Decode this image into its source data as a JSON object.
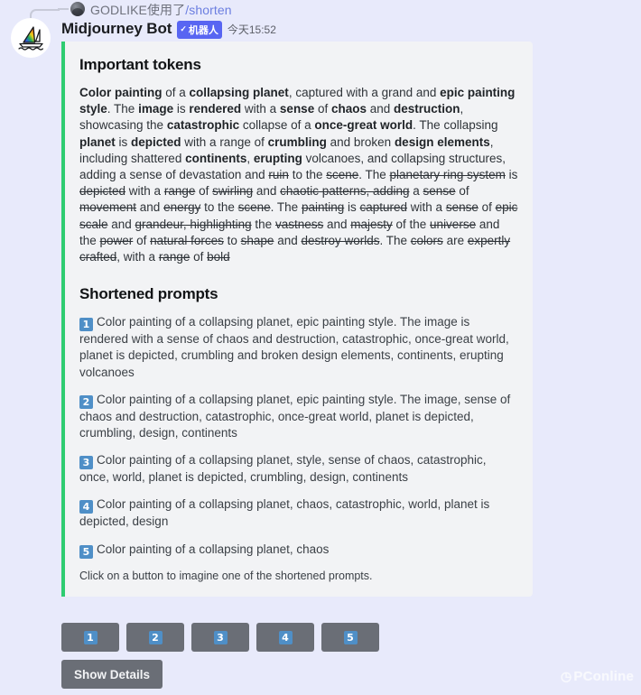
{
  "reply": {
    "username": "GODLIKE",
    "action": "使用了",
    "command": "/shorten",
    "avatar_icon": "user-avatar-icon"
  },
  "message": {
    "author": "Midjourney Bot",
    "bot_badge_check": "✓",
    "bot_badge_label": "机器人",
    "timestamp": "今天15:52",
    "avatar_icon": "midjourney-sailboat-icon"
  },
  "embed": {
    "accent_color": "#2ecc71",
    "background_color": "#f2f3f5",
    "tokens_title": "Important tokens",
    "prompts_title": "Shortened prompts",
    "footnote": "Click on a button to imagine one of the shortened prompts.",
    "tokens_segments": [
      {
        "text": "Color painting",
        "style": "bold"
      },
      {
        "text": " of a ",
        "style": "normal"
      },
      {
        "text": "collapsing planet",
        "style": "bold"
      },
      {
        "text": ", captured with a grand and ",
        "style": "normal"
      },
      {
        "text": "epic painting style",
        "style": "bold"
      },
      {
        "text": ". The ",
        "style": "normal"
      },
      {
        "text": "image",
        "style": "bold"
      },
      {
        "text": " is ",
        "style": "normal"
      },
      {
        "text": "rendered",
        "style": "bold"
      },
      {
        "text": " with a ",
        "style": "normal"
      },
      {
        "text": "sense",
        "style": "bold"
      },
      {
        "text": " of ",
        "style": "normal"
      },
      {
        "text": "chaos",
        "style": "bold"
      },
      {
        "text": " and ",
        "style": "normal"
      },
      {
        "text": "destruction",
        "style": "bold"
      },
      {
        "text": ", showcasing the ",
        "style": "normal"
      },
      {
        "text": "catastrophic",
        "style": "bold"
      },
      {
        "text": " collapse of a ",
        "style": "normal"
      },
      {
        "text": "once-great world",
        "style": "bold"
      },
      {
        "text": ". The collapsing ",
        "style": "normal"
      },
      {
        "text": "planet",
        "style": "bold"
      },
      {
        "text": " is ",
        "style": "normal"
      },
      {
        "text": "depicted",
        "style": "bold"
      },
      {
        "text": " with a range of ",
        "style": "normal"
      },
      {
        "text": "crumbling",
        "style": "bold"
      },
      {
        "text": " and broken ",
        "style": "normal"
      },
      {
        "text": "design elements",
        "style": "bold"
      },
      {
        "text": ", including shattered ",
        "style": "normal"
      },
      {
        "text": "continents",
        "style": "bold"
      },
      {
        "text": ", ",
        "style": "normal"
      },
      {
        "text": "erupting",
        "style": "bold"
      },
      {
        "text": " volcanoes, and collapsing structures, adding a sense of devastation and ",
        "style": "normal"
      },
      {
        "text": "ruin",
        "style": "strike"
      },
      {
        "text": " to the ",
        "style": "normal"
      },
      {
        "text": "scene",
        "style": "strike"
      },
      {
        "text": ". The ",
        "style": "normal"
      },
      {
        "text": "planetary ring system",
        "style": "strike"
      },
      {
        "text": " is ",
        "style": "normal"
      },
      {
        "text": "depicted",
        "style": "strike"
      },
      {
        "text": " with a ",
        "style": "normal"
      },
      {
        "text": "range",
        "style": "strike"
      },
      {
        "text": " of ",
        "style": "normal"
      },
      {
        "text": "swirling",
        "style": "strike"
      },
      {
        "text": " and ",
        "style": "normal"
      },
      {
        "text": "chaotic patterns, adding",
        "style": "strike"
      },
      {
        "text": " a ",
        "style": "normal"
      },
      {
        "text": "sense",
        "style": "strike"
      },
      {
        "text": " of ",
        "style": "normal"
      },
      {
        "text": "movement",
        "style": "strike"
      },
      {
        "text": " and ",
        "style": "normal"
      },
      {
        "text": "energy",
        "style": "strike"
      },
      {
        "text": " to the ",
        "style": "normal"
      },
      {
        "text": "scene",
        "style": "strike"
      },
      {
        "text": ". The ",
        "style": "normal"
      },
      {
        "text": "painting",
        "style": "strike"
      },
      {
        "text": " is ",
        "style": "normal"
      },
      {
        "text": "captured",
        "style": "strike"
      },
      {
        "text": " with a ",
        "style": "normal"
      },
      {
        "text": "sense",
        "style": "strike"
      },
      {
        "text": " of ",
        "style": "normal"
      },
      {
        "text": "epic scale",
        "style": "strike"
      },
      {
        "text": " and ",
        "style": "normal"
      },
      {
        "text": "grandeur, highlighting",
        "style": "strike"
      },
      {
        "text": " the ",
        "style": "normal"
      },
      {
        "text": "vastness",
        "style": "strike"
      },
      {
        "text": " and ",
        "style": "normal"
      },
      {
        "text": "majesty",
        "style": "strike"
      },
      {
        "text": " of the ",
        "style": "normal"
      },
      {
        "text": "universe",
        "style": "strike"
      },
      {
        "text": " and the ",
        "style": "normal"
      },
      {
        "text": "power",
        "style": "strike"
      },
      {
        "text": " of ",
        "style": "normal"
      },
      {
        "text": "natural forces",
        "style": "strike"
      },
      {
        "text": " to ",
        "style": "normal"
      },
      {
        "text": "shape",
        "style": "strike"
      },
      {
        "text": " and ",
        "style": "normal"
      },
      {
        "text": "destroy worlds",
        "style": "strike"
      },
      {
        "text": ". The ",
        "style": "normal"
      },
      {
        "text": "colors",
        "style": "strike"
      },
      {
        "text": " are ",
        "style": "normal"
      },
      {
        "text": "expertly crafted",
        "style": "strike"
      },
      {
        "text": ", with a ",
        "style": "normal"
      },
      {
        "text": "range",
        "style": "strike"
      },
      {
        "text": " of ",
        "style": "normal"
      },
      {
        "text": "bold",
        "style": "strike"
      }
    ],
    "prompts": [
      {
        "number": "1",
        "text": "Color painting of a collapsing planet, epic painting style. The image is rendered with a sense of chaos and destruction, catastrophic, once-great world, planet is depicted, crumbling and broken design elements, continents, erupting volcanoes"
      },
      {
        "number": "2",
        "text": "Color painting of a collapsing planet, epic painting style. The image, sense of chaos and destruction, catastrophic, once-great world, planet is depicted, crumbling, design, continents"
      },
      {
        "number": "3",
        "text": "Color painting of a collapsing planet, style, sense of chaos, catastrophic, once, world, planet is depicted, crumbling, design, continents"
      },
      {
        "number": "4",
        "text": "Color painting of a collapsing planet, chaos, catastrophic, world, planet is depicted, design"
      },
      {
        "number": "5",
        "text": "Color painting of a collapsing planet, chaos"
      }
    ]
  },
  "actions": {
    "number_buttons": [
      "1",
      "2",
      "3",
      "4",
      "5"
    ],
    "show_details_label": "Show Details",
    "button_color": "#6a6e76",
    "keycap_color": "#4f8fc7"
  },
  "watermark": {
    "mark": "◷",
    "label": "PConline"
  }
}
